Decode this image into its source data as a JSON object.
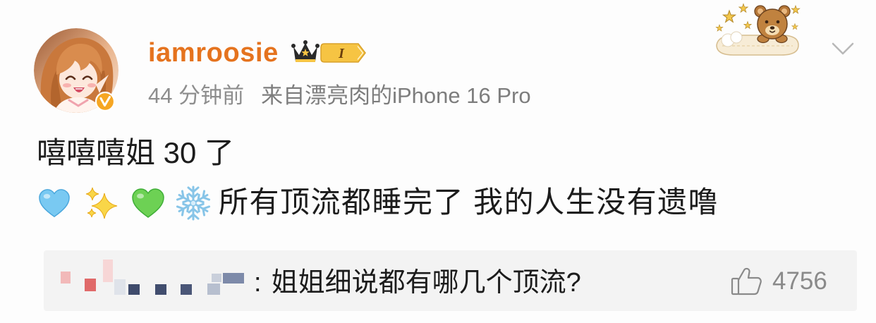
{
  "post": {
    "author": {
      "username": "iamroosie",
      "level_badge": "I"
    },
    "meta": {
      "time": "44 分钟前",
      "source": "来自漂亮肉的iPhone 16 Pro"
    },
    "content": {
      "line1": "嘻嘻嘻姐 30 了",
      "emojis": [
        "blue-heart-emoji",
        "sparkles-emoji",
        "green-heart-emoji",
        "snowflake-emoji"
      ],
      "line2": "所有顶流都睡完了 我的人生没有遗噜"
    }
  },
  "top_comment": {
    "separator": ":",
    "text": "姐姐细说都有哪几个顶流?",
    "likes": "4756"
  },
  "icons": {
    "avatar": "avatar-anime-girl-icon",
    "verified": "verified-v-icon",
    "vip": "crown-icon",
    "more": "chevron-down-icon",
    "decoration": "teddy-bear-sticker-icon",
    "like": "thumbs-up-icon"
  },
  "colors": {
    "username": "#e5731e",
    "meta": "#8e8e8e",
    "source": "#7d7d7d",
    "text": "#1c1c1c",
    "comment_bg": "#f3f3f3",
    "likes": "#8a8a8a",
    "verified": "#f6a623",
    "badge_gold": "#f6c443"
  }
}
